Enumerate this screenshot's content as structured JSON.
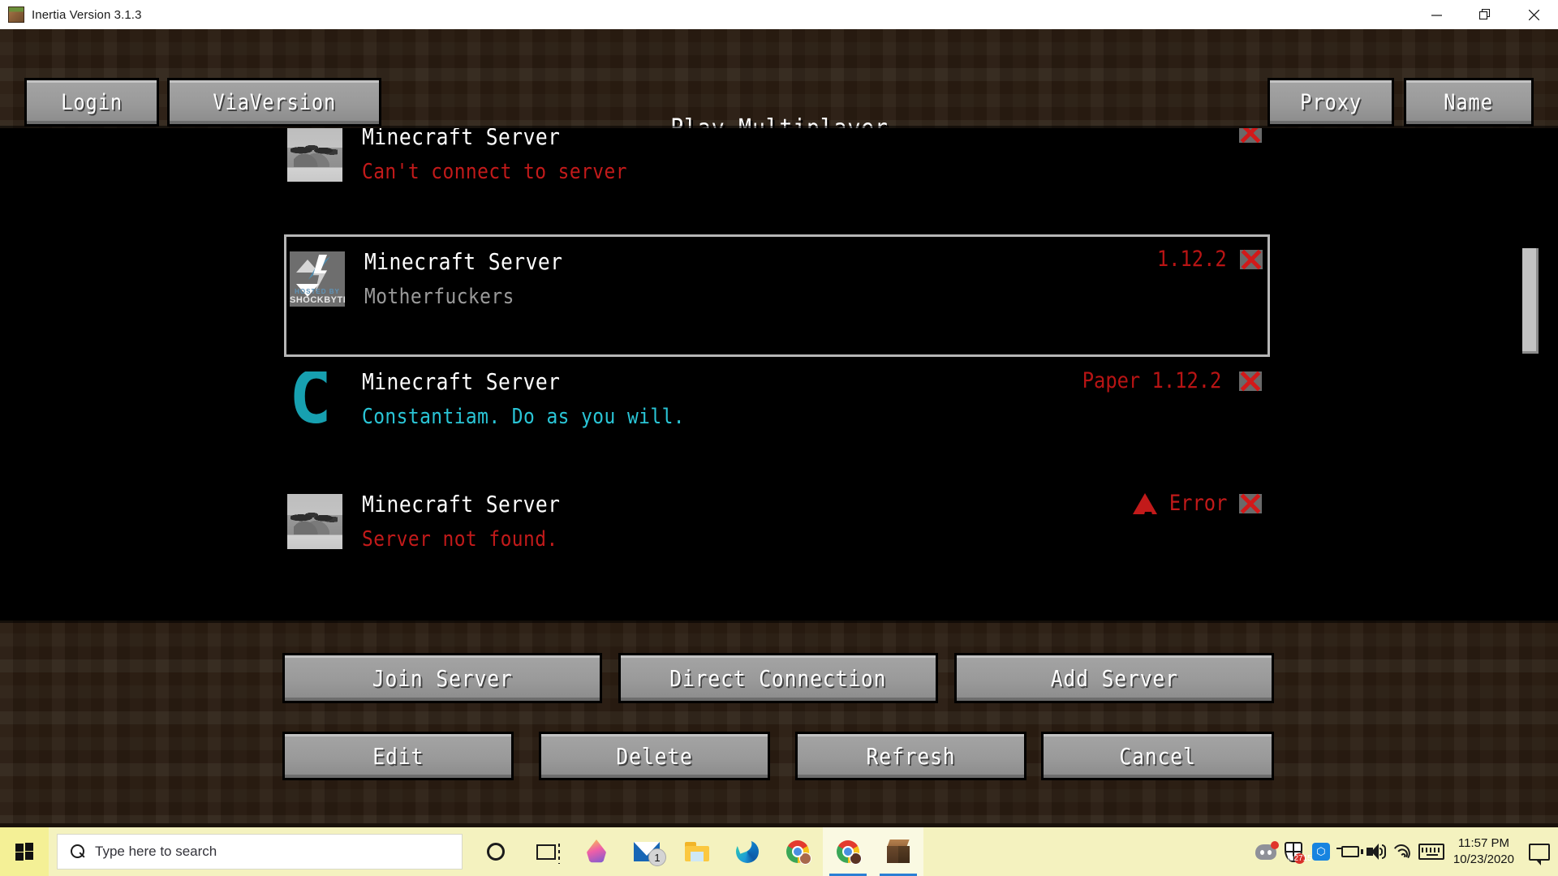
{
  "window": {
    "title": "Inertia Version 3.1.3",
    "icon": "grass-block-icon",
    "controls": {
      "minimize": "—",
      "restore": "❐",
      "close": "✕"
    }
  },
  "header": {
    "page_title": "Play Multiplayer",
    "buttons": {
      "login": "Login",
      "viaversion": "ViaVersion",
      "proxy": "Proxy",
      "name": "Name"
    }
  },
  "servers": [
    {
      "name": "Minecraft Server",
      "motd": "Can't connect to server",
      "motd_color": "#c21a1a",
      "version": "",
      "icon": "landscape-icon",
      "selected": false,
      "error_badge": false,
      "ping": "ping-x-icon"
    },
    {
      "name": "Minecraft Server",
      "motd": "Motherfuckers",
      "motd_color": "#9a9a9a",
      "version": "1.12.2",
      "icon": "shockbyte-icon",
      "icon_text_small": "HOSTED BY",
      "icon_text": "SHOCKBYTE",
      "selected": true,
      "error_badge": false,
      "ping": "ping-x-icon"
    },
    {
      "name": "Minecraft Server",
      "motd": "Constantiam. Do as you will.",
      "motd_color": "#2ac5d6",
      "version": "Paper 1.12.2",
      "icon": "letter-c-icon",
      "icon_glyph": "C",
      "selected": false,
      "error_badge": false,
      "ping": "ping-x-icon"
    },
    {
      "name": "Minecraft Server",
      "motd": "Server not found.",
      "motd_color": "#c21a1a",
      "version": "Error",
      "icon": "landscape-icon",
      "selected": false,
      "error_badge": true,
      "ping": "ping-x-icon"
    }
  ],
  "colors": {
    "version_red": "#b81414",
    "error_red": "#c21a1a",
    "cyan_motd": "#2ac5d6",
    "gray_motd": "#9a9a9a",
    "taskbar_bg": "#f4f2bf",
    "selected_border": "#b6b6b6"
  },
  "bottom_buttons": {
    "row1": [
      "Join Server",
      "Direct Connection",
      "Add Server"
    ],
    "row2": [
      "Edit",
      "Delete",
      "Refresh",
      "Cancel"
    ]
  },
  "taskbar": {
    "start": "windows-logo",
    "search_placeholder": "Type here to search",
    "icons": [
      "cortana-icon",
      "task-view-icon",
      "paint3d-icon",
      "mail-icon",
      "file-explorer-icon",
      "edge-icon",
      "chrome-icon",
      "chrome-icon-2",
      "minecraft-icon"
    ],
    "mail_badge": "1",
    "tray": [
      "discord-icon",
      "windows-defender-icon",
      "bluetooth-icon",
      "battery-charging-icon",
      "volume-icon",
      "wifi-icon",
      "keyboard-icon"
    ],
    "clock_time": "11:57 PM",
    "clock_date": "10/23/2020",
    "notification": "notification-icon"
  }
}
